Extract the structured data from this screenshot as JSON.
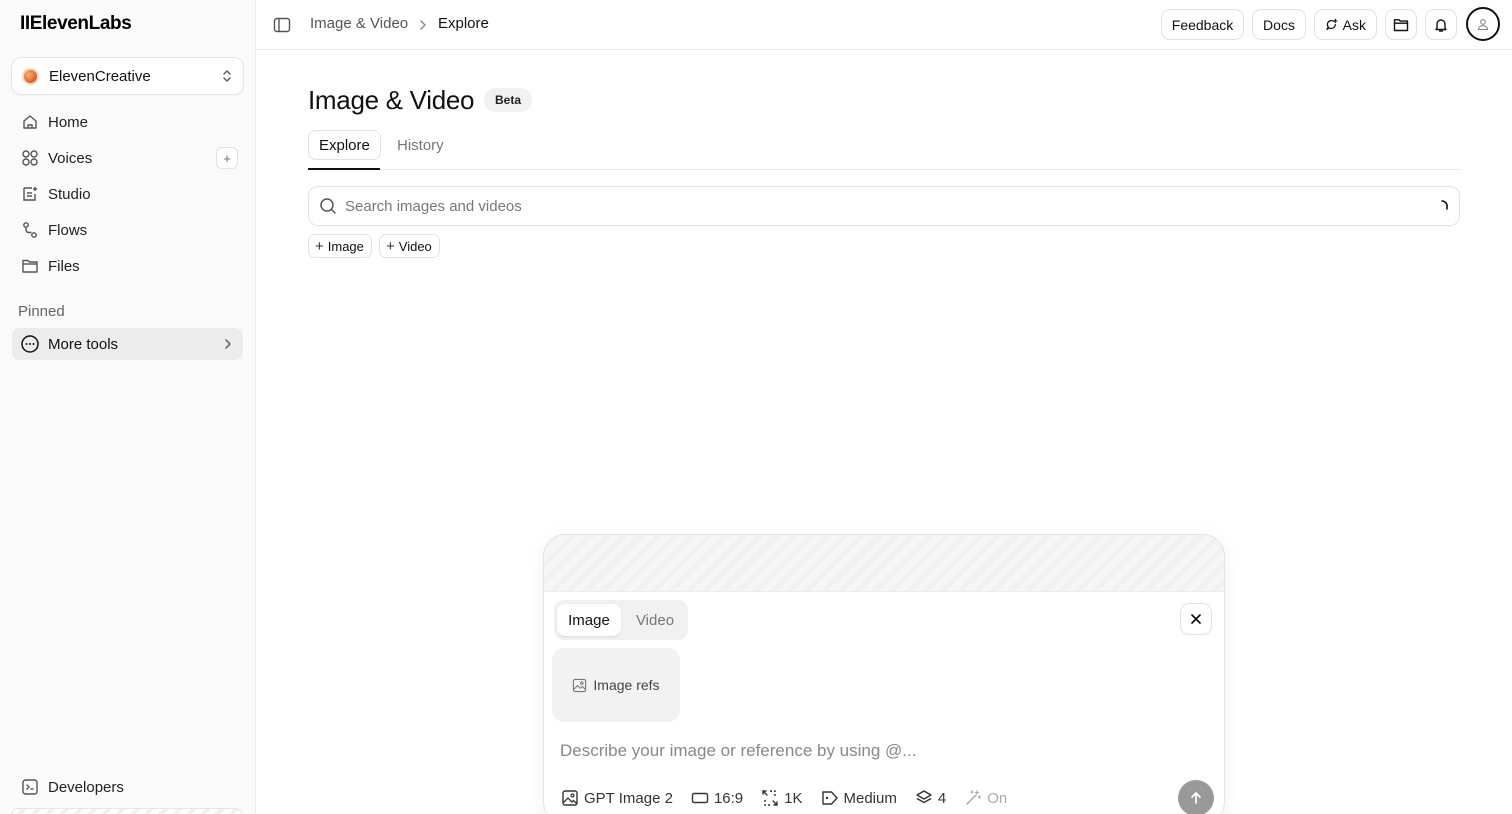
{
  "sidebar": {
    "logo": "IIElevenLabs",
    "workspace": "ElevenCreative",
    "items": [
      {
        "label": "Home"
      },
      {
        "label": "Voices",
        "add": "+"
      },
      {
        "label": "Studio"
      },
      {
        "label": "Flows"
      },
      {
        "label": "Files"
      }
    ],
    "pinned_label": "Pinned",
    "more_tools": "More tools",
    "developers": "Developers"
  },
  "header": {
    "breadcrumb": [
      "Image & Video",
      "Explore"
    ],
    "feedback": "Feedback",
    "docs": "Docs",
    "ask": "Ask"
  },
  "main": {
    "title": "Image & Video",
    "badge": "Beta",
    "tabs": [
      {
        "label": "Explore"
      },
      {
        "label": "History"
      }
    ],
    "search_placeholder": "Search images and videos",
    "filters": [
      {
        "label": "Image"
      },
      {
        "label": "Video"
      }
    ]
  },
  "composer": {
    "modes": [
      "Image",
      "Video"
    ],
    "refs_label": "Image refs",
    "prompt_placeholder": "Describe your image or reference by using @...",
    "options": {
      "model": "GPT Image 2",
      "aspect": "16:9",
      "resolution": "1K",
      "quality": "Medium",
      "count": "4",
      "enhance": "On"
    }
  }
}
